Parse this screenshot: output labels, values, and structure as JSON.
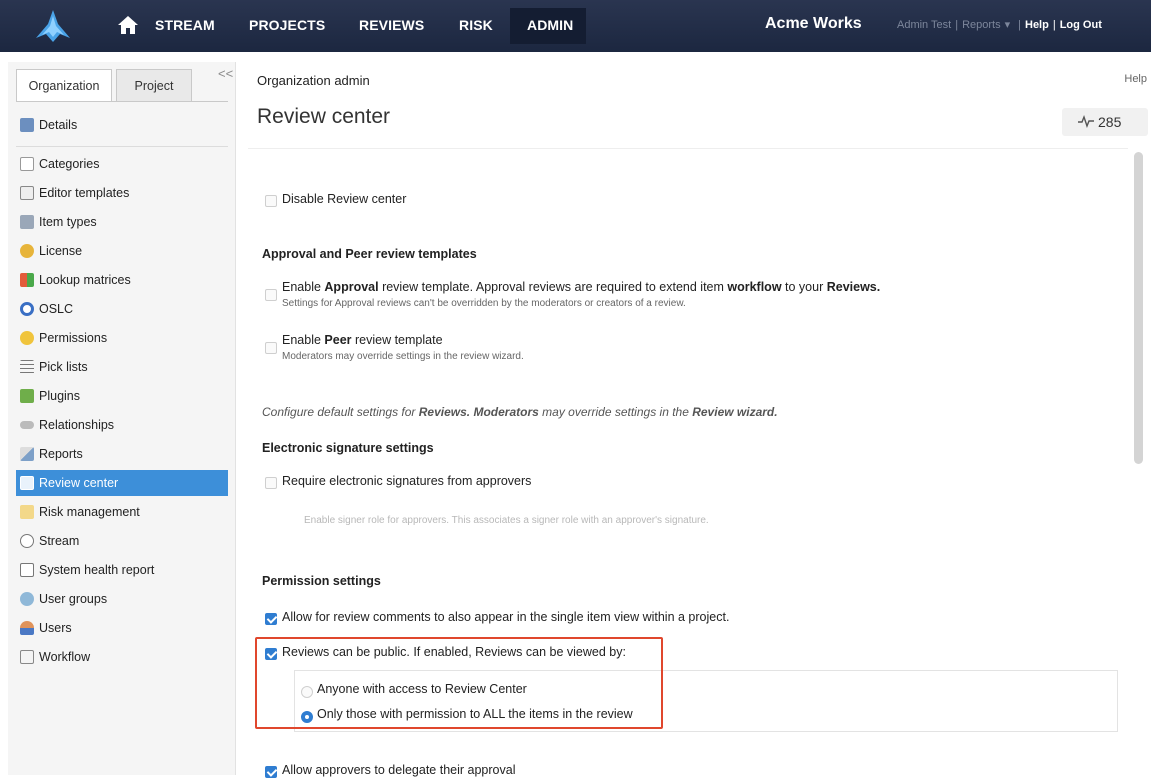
{
  "topnav": {
    "items": [
      "STREAM",
      "PROJECTS",
      "REVIEWS",
      "RISK",
      "ADMIN"
    ],
    "brand": "Acme Works",
    "user_link": "Admin Test",
    "reports_link": "Reports",
    "help_link": "Help",
    "logout_link": "Log Out"
  },
  "sidebar": {
    "tabs": [
      "Organization",
      "Project"
    ],
    "collapse_glyph": "<<",
    "items": [
      {
        "label": "Details",
        "icon": "details-icon"
      },
      {
        "label": "Categories",
        "icon": "tag-icon"
      },
      {
        "label": "Editor templates",
        "icon": "template-icon"
      },
      {
        "label": "Item types",
        "icon": "list-icon"
      },
      {
        "label": "License",
        "icon": "key-icon"
      },
      {
        "label": "Lookup matrices",
        "icon": "grid-icon"
      },
      {
        "label": "OSLC",
        "icon": "oslc-icon"
      },
      {
        "label": "Permissions",
        "icon": "lock-icon"
      },
      {
        "label": "Pick lists",
        "icon": "list-lines-icon"
      },
      {
        "label": "Plugins",
        "icon": "plugin-icon"
      },
      {
        "label": "Relationships",
        "icon": "link-icon"
      },
      {
        "label": "Reports",
        "icon": "chart-icon"
      },
      {
        "label": "Review center",
        "icon": "review-icon"
      },
      {
        "label": "Risk management",
        "icon": "risk-icon"
      },
      {
        "label": "Stream",
        "icon": "speech-icon"
      },
      {
        "label": "System health report",
        "icon": "health-icon"
      },
      {
        "label": "User groups",
        "icon": "group-icon"
      },
      {
        "label": "Users",
        "icon": "user-icon"
      },
      {
        "label": "Workflow",
        "icon": "workflow-icon"
      }
    ],
    "selected": "Review center"
  },
  "main": {
    "breadcrumb": "Organization admin",
    "help": "Help",
    "title": "Review center",
    "counter": "285",
    "disable_label": "Disable Review center",
    "templates_heading": "Approval and Peer review templates",
    "approval_parts": [
      "Enable ",
      "Approval",
      " review template. Approval reviews are required to extend item ",
      "workflow",
      " to your ",
      "Reviews."
    ],
    "approval_sub": "Settings for Approval reviews can't be overridden by the moderators or creators of a review.",
    "peer_parts": [
      "Enable ",
      "Peer",
      " review template"
    ],
    "peer_sub": "Moderators may override settings in the review wizard.",
    "configure_parts": [
      "Configure default settings for ",
      "Reviews. Moderators",
      " may override settings in the ",
      "Review wizard."
    ],
    "esig_heading": "Electronic signature settings",
    "esig_label": "Require electronic signatures from approvers",
    "esig_sub": "Enable signer role for approvers. This associates a signer role with an approver's signature.",
    "perm_heading": "Permission settings",
    "perm_comments": "Allow for review comments to also appear in the single item view within a project.",
    "perm_public": "Reviews can be public. If enabled, Reviews can be viewed by:",
    "radio_anyone": "Anyone with access to Review Center",
    "radio_only": "Only those with permission to ALL the items in the review",
    "delegate": "Allow approvers to delegate their approval"
  },
  "state": {
    "disable": false,
    "approval": false,
    "peer": false,
    "esig": false,
    "perm_comments": true,
    "perm_public": true,
    "visibility": "only",
    "delegate": true
  },
  "colors": {
    "topbar": "#1c2740",
    "accent": "#2f7dd1",
    "selected_item": "#3d8fd9",
    "highlight_box": "#e0472d"
  }
}
